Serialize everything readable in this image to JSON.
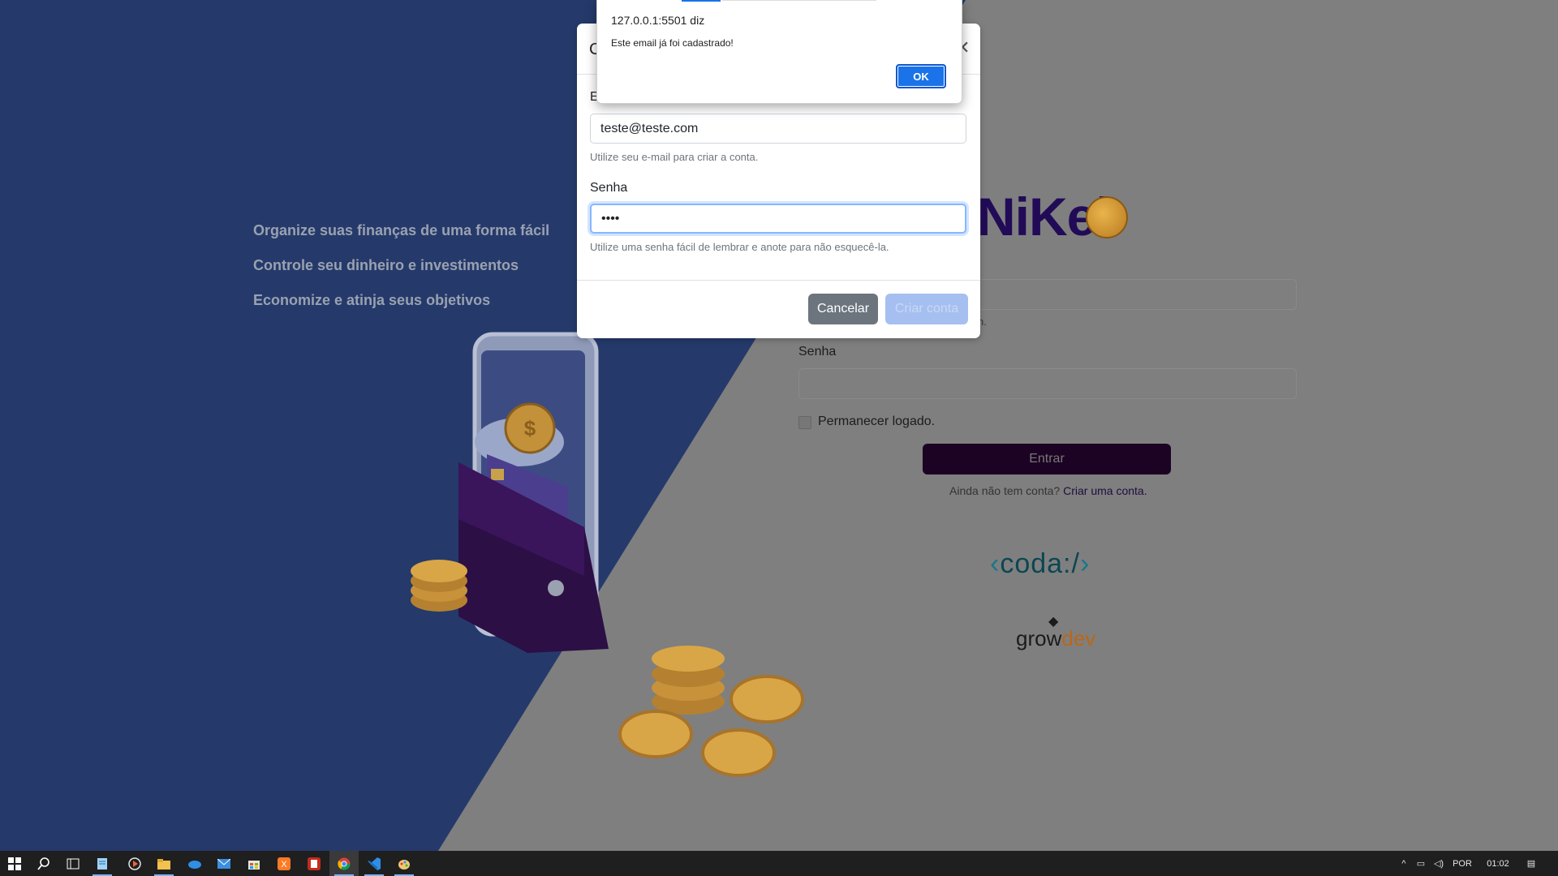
{
  "background_page": {
    "features": [
      "Organize suas finanças de uma forma fácil",
      "Controle seu dinheiro e investimentos",
      "Economize e atinja seus objetivos"
    ],
    "brand": "NiKel",
    "email_help_partial": "n.",
    "password_label": "Senha",
    "remember_label": "Permanecer logado.",
    "login_button": "Entrar",
    "signup_prompt": "Ainda não tem conta?",
    "signup_link": "Criar uma conta.",
    "coda_logo": "coda:/",
    "growdev_logo": {
      "grow": "grow",
      "dev": "dev"
    }
  },
  "modal": {
    "title_fragment": "C",
    "email_label_fragment": "E",
    "email_value": "teste@teste.com",
    "email_help": "Utilize seu e-mail para criar a conta.",
    "password_label": "Senha",
    "password_value": "••••",
    "password_help": "Utilize uma senha fácil de lembrar e anote para não esquecê-la.",
    "cancel_button": "Cancelar",
    "create_button": "Criar conta"
  },
  "alert": {
    "origin": "127.0.0.1:5501 diz",
    "message": "Este email já foi cadastrado!",
    "ok_button": "OK"
  },
  "taskbar": {
    "icons": [
      "windows-start-icon",
      "search-icon",
      "task-view-icon",
      "notepad-icon",
      "media-player-icon",
      "file-explorer-icon",
      "onedrive-icon",
      "mail-icon",
      "store-icon",
      "xampp-icon",
      "app-icon",
      "chrome-icon",
      "vscode-icon",
      "paint-icon"
    ],
    "language": "POR",
    "time": "01:02"
  },
  "colors": {
    "left_bg": "#253a6b",
    "right_bg": "#7f7f7f",
    "brand": "#210b57",
    "button_dark": "#1c0324",
    "alert_ok": "#1a73e8"
  }
}
